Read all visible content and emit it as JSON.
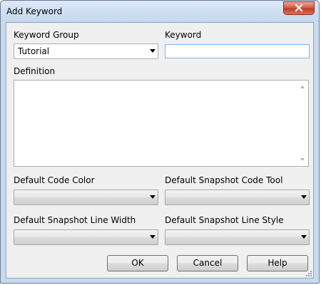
{
  "window": {
    "title": "Add Keyword"
  },
  "form": {
    "keyword_group_label": "Keyword Group",
    "keyword_group_value": "Tutorial",
    "keyword_label": "Keyword",
    "keyword_value": "",
    "definition_label": "Definition",
    "definition_value": "",
    "default_code_color_label": "Default Code Color",
    "default_code_color_value": "",
    "default_snapshot_code_tool_label": "Default Snapshot Code Tool",
    "default_snapshot_code_tool_value": "",
    "default_snapshot_line_width_label": "Default Snapshot Line Width",
    "default_snapshot_line_width_value": "",
    "default_snapshot_line_style_label": "Default Snapshot Line Style",
    "default_snapshot_line_style_value": ""
  },
  "buttons": {
    "ok_label": "OK",
    "cancel_label": "Cancel",
    "help_label": "Help"
  },
  "icons": {
    "close": "close-icon",
    "dropdown": "chevron-down-icon",
    "resize": "resize-grip-icon"
  },
  "colors": {
    "close_button": "#c1391f",
    "focus_border": "#7eb4ea",
    "window_frame": "#c8daef"
  }
}
